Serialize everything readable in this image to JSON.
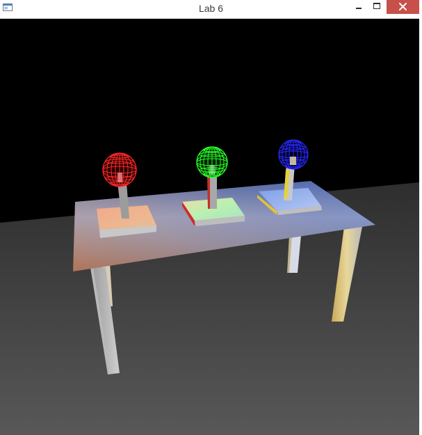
{
  "window": {
    "title": "Lab 6",
    "icon": "app-window-icon",
    "controls": {
      "minimize_icon": "minimize-icon",
      "maximize_icon": "maximize-icon",
      "close_icon": "close-icon",
      "close_color": "#c7504a"
    }
  },
  "scene": {
    "background_color": "#000000",
    "floor_color": "#4a4a4a",
    "spheres": [
      {
        "color": "#ff1a1a"
      },
      {
        "color": "#1aff1a"
      },
      {
        "color": "#1a1aff"
      }
    ]
  }
}
